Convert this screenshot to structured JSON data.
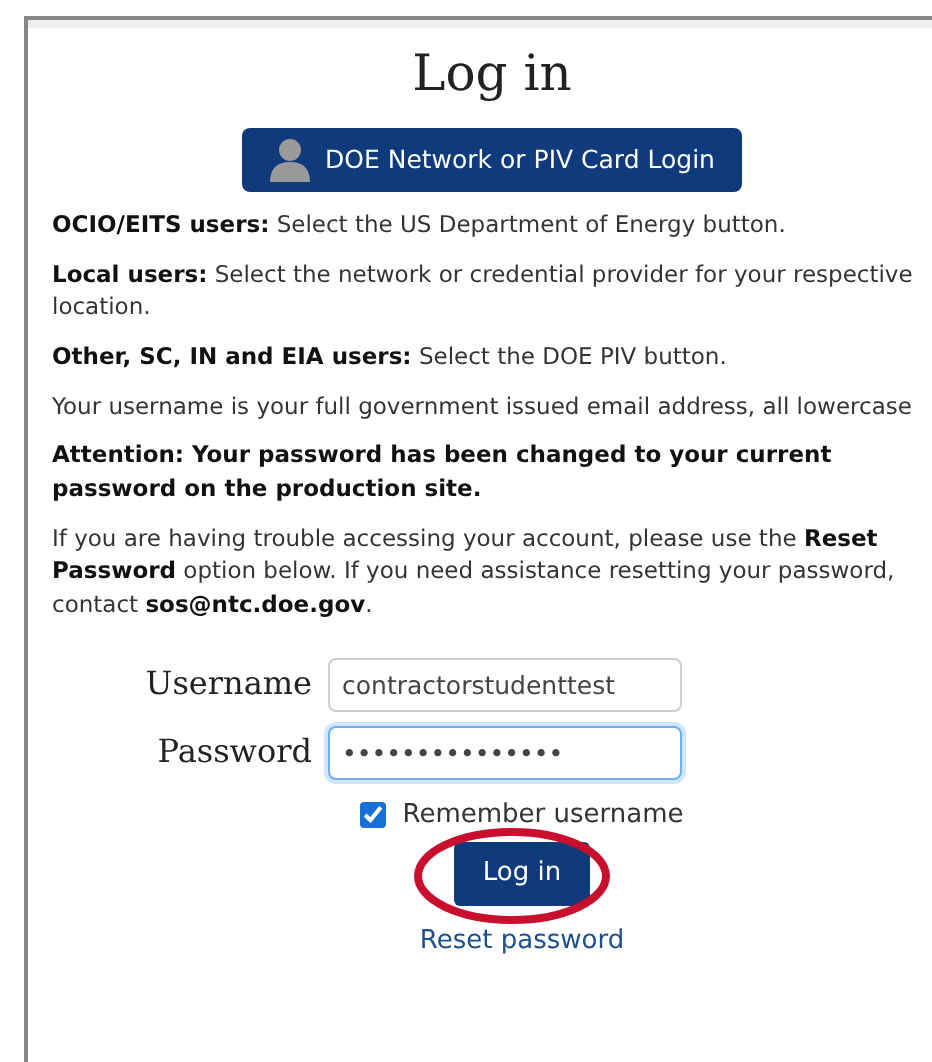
{
  "title": "Log in",
  "sso_button": {
    "label": "DOE Network or PIV Card Login"
  },
  "instructions": [
    {
      "text": "**OCIO/EITS users:** Select the US Department of Energy button."
    },
    {
      "text": "**Local users:** Select the network or credential provider for your respective location."
    },
    {
      "text": "**Other, SC, IN and EIA users:** Select the DOE PIV button."
    },
    {
      "text": "Your username is your full government issued email address, all lowercase"
    },
    {
      "text": "**Attention: Your password has been changed to your current password on the production site.**"
    },
    {
      "text": "If you are having trouble accessing your account, please use the **Reset Password** option below. If you need assistance resetting your password, contact **sos@ntc.doe.gov**."
    }
  ],
  "form": {
    "username": {
      "label": "Username",
      "value": "contractorstudenttest"
    },
    "password": {
      "label": "Password",
      "value": "•••••••••••••••",
      "focused": true
    },
    "remember": {
      "label": "Remember username",
      "checked": true
    },
    "submit": {
      "label": "Log in",
      "highlighted": true
    },
    "reset_link": "Reset password"
  }
}
